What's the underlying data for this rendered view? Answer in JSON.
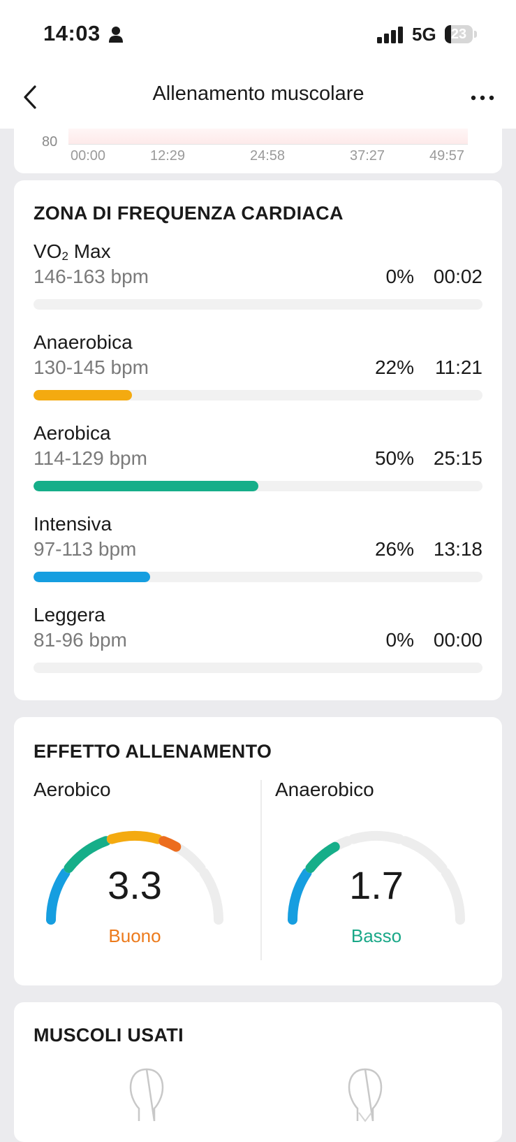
{
  "status": {
    "time": "14:03",
    "network": "5G",
    "battery": "23",
    "battery_level": 0.23
  },
  "nav": {
    "title": "Allenamento muscolare"
  },
  "hr_chart": {
    "y_tick": "80",
    "x_ticks": [
      "00:00",
      "12:29",
      "24:58",
      "37:27",
      "49:57"
    ]
  },
  "zones": {
    "title": "ZONA DI FREQUENZA CARDIACA",
    "items": [
      {
        "name": "VO",
        "sub": "2",
        "suffix": " Max",
        "range": "146-163 bpm",
        "pct": "0%",
        "time": "00:02",
        "fraction": 0.0,
        "color": "#f3a713"
      },
      {
        "name": "Anaerobica",
        "sub": "",
        "suffix": "",
        "range": "130-145 bpm",
        "pct": "22%",
        "time": "11:21",
        "fraction": 0.22,
        "color": "#f4aa10"
      },
      {
        "name": "Aerobica",
        "sub": "",
        "suffix": "",
        "range": "114-129 bpm",
        "pct": "50%",
        "time": "25:15",
        "fraction": 0.5,
        "color": "#16ae89"
      },
      {
        "name": "Intensiva",
        "sub": "",
        "suffix": "",
        "range": "97-113 bpm",
        "pct": "26%",
        "time": "13:18",
        "fraction": 0.26,
        "color": "#169ee0"
      },
      {
        "name": "Leggera",
        "sub": "",
        "suffix": "",
        "range": "81-96 bpm",
        "pct": "0%",
        "time": "00:00",
        "fraction": 0.0,
        "color": "#9a9a9a"
      }
    ]
  },
  "effect": {
    "title": "EFFETTO ALLENAMENTO",
    "gauges": [
      {
        "label": "Aerobico",
        "value": "3.3",
        "rating": "Buono",
        "rating_color": "#ec7a1c",
        "level": 3.3
      },
      {
        "label": "Anaerobico",
        "value": "1.7",
        "rating": "Basso",
        "rating_color": "#1aa888",
        "level": 1.7
      }
    ],
    "segment_colors": [
      "#169ee0",
      "#16ae89",
      "#f4aa10",
      "#ec6d1e",
      "#ededed"
    ]
  },
  "muscles": {
    "title": "MUSCOLI USATI"
  }
}
